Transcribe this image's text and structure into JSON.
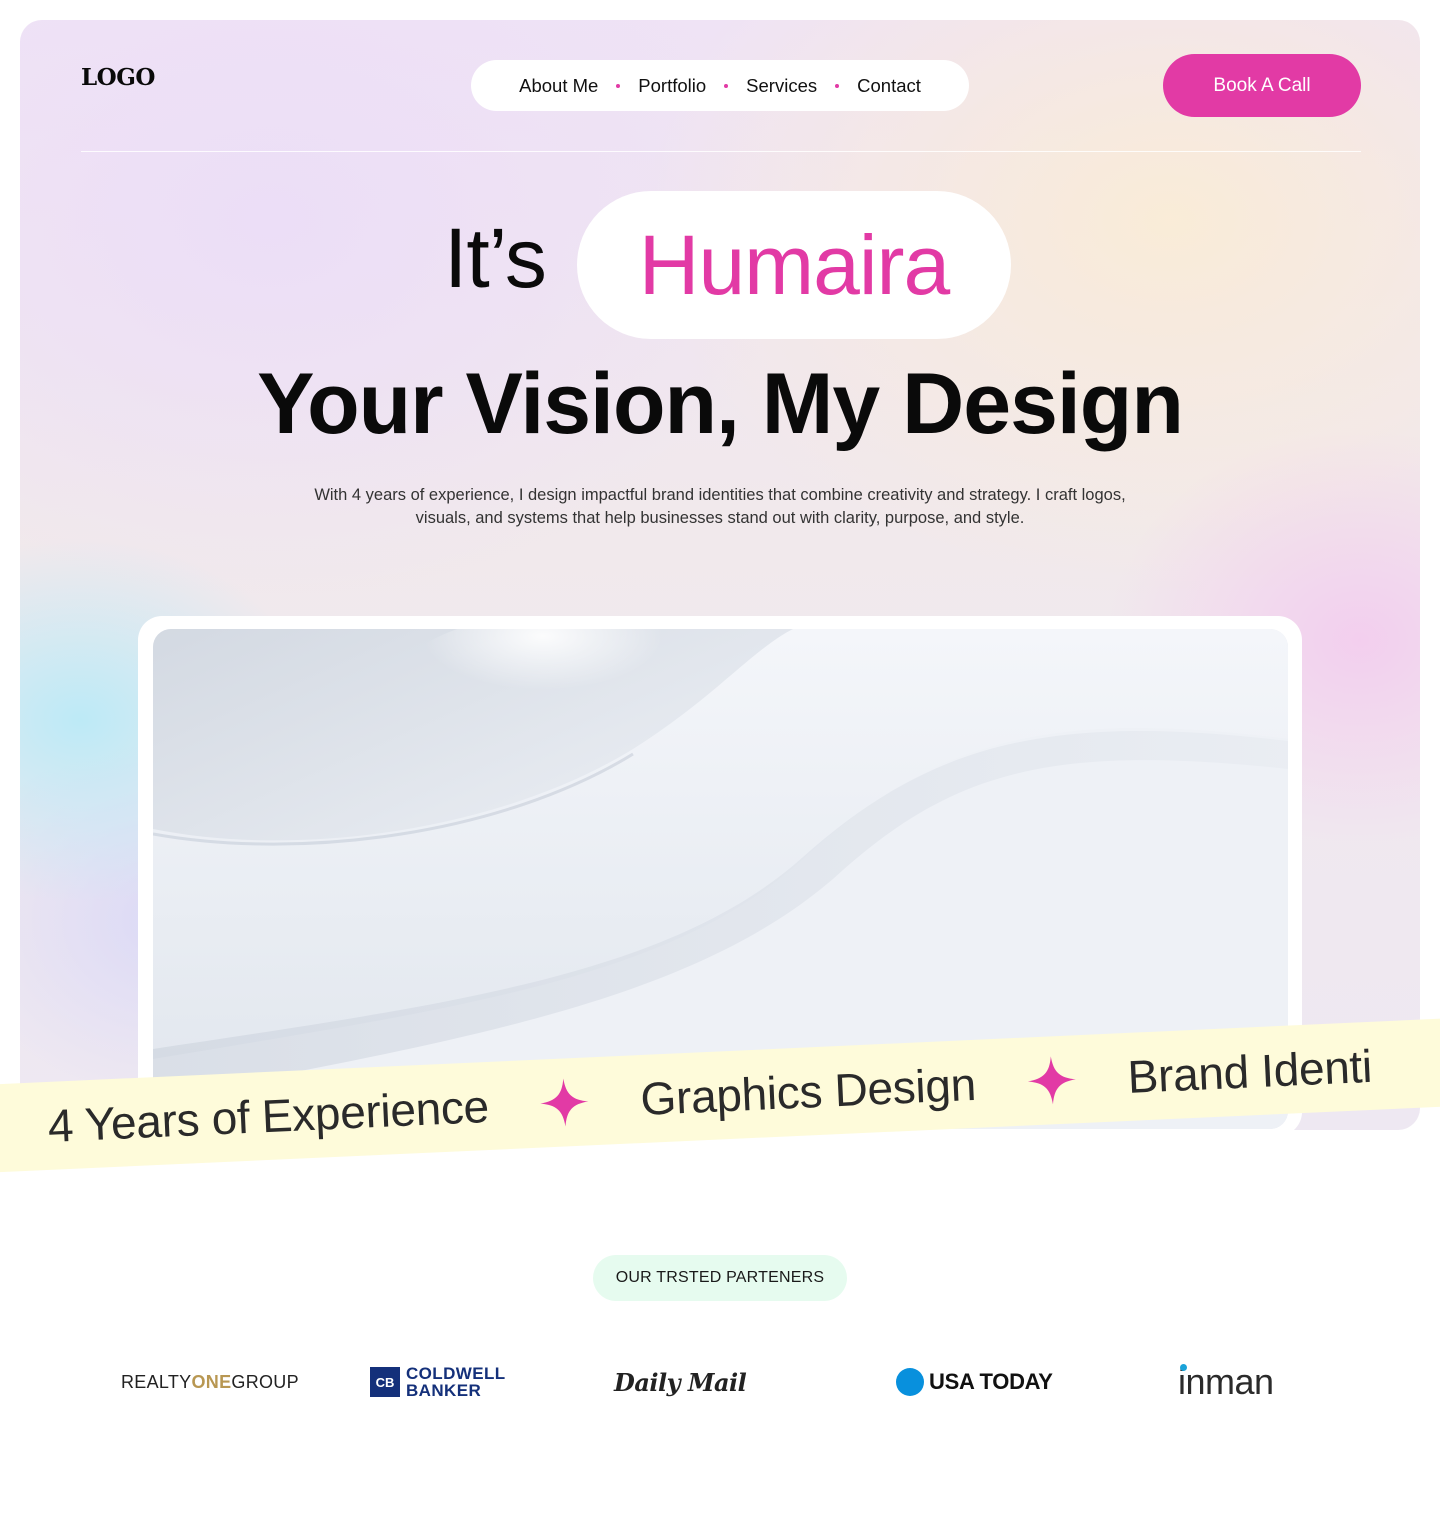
{
  "header": {
    "logo": "LOGO",
    "nav": [
      "About Me",
      "Portfolio",
      "Services",
      "Contact"
    ],
    "cta_label": "Book A Call"
  },
  "hero": {
    "intro": "It’s",
    "name": "Humaira",
    "headline": "Your Vision, My Design",
    "description": "With 4 years of experience, I design impactful brand identities that combine creativity and strategy. I craft logos, visuals, and systems that help businesses stand out with clarity, purpose, and style."
  },
  "ribbon": {
    "items": [
      "4 Years of Experience",
      "Graphics Design",
      "Brand Identi"
    ],
    "separator_icon": "four-point-star-icon"
  },
  "partners": {
    "badge": "OUR TRSTED PARTENERS",
    "logos": {
      "realty": {
        "part1": "REALTY",
        "part2": "ONE",
        "part3": "GROUP"
      },
      "coldwell": {
        "mark": "CB",
        "line1": "COLDWELL",
        "line2": "BANKER"
      },
      "dailymail": "Daily Mail",
      "usatoday": "USA TODAY",
      "inman": "inman"
    }
  },
  "colors": {
    "accent": "#e23aa5",
    "ribbon": "#fefbda",
    "badge": "#e6fbef"
  }
}
